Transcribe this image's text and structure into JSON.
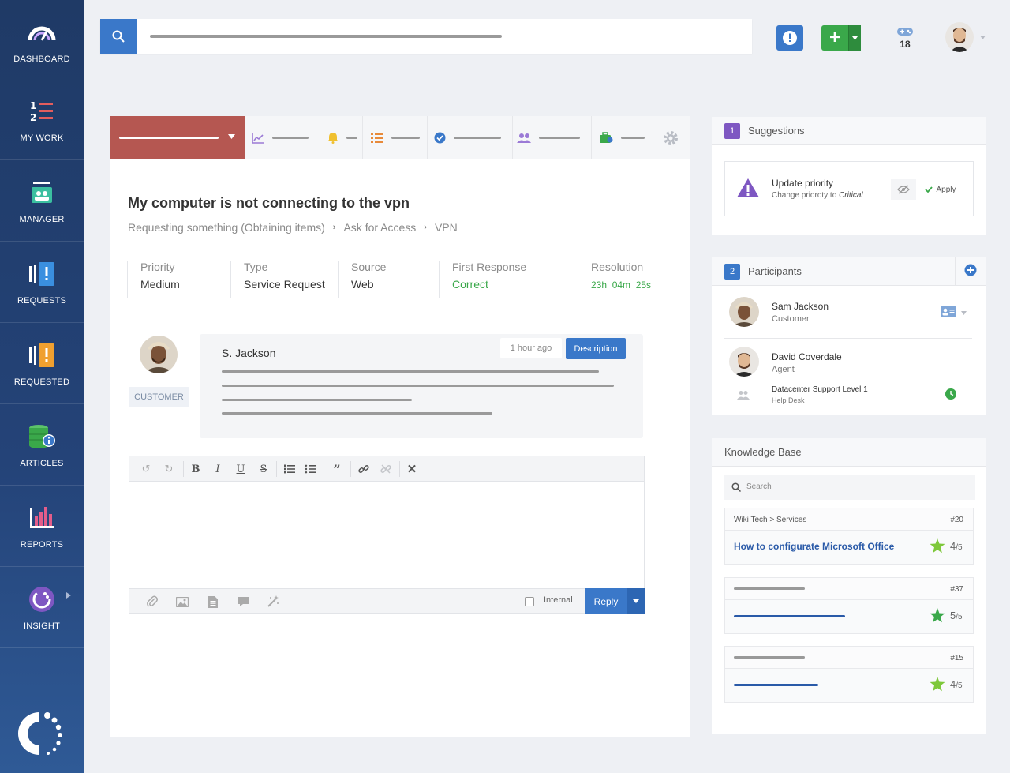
{
  "sidebar": {
    "items": [
      {
        "label": "DASHBOARD",
        "icon": "speedometer-icon"
      },
      {
        "label": "MY WORK",
        "icon": "numbered-list-icon"
      },
      {
        "label": "MANAGER",
        "icon": "manager-icon"
      },
      {
        "label": "REQUESTS",
        "icon": "requests-icon"
      },
      {
        "label": "REQUESTED",
        "icon": "requested-icon"
      },
      {
        "label": "ARTICLES",
        "icon": "database-icon"
      },
      {
        "label": "REPORTS",
        "icon": "bar-chart-icon"
      },
      {
        "label": "INSIGHT",
        "icon": "insight-icon"
      }
    ]
  },
  "topbar": {
    "notifications_count": "18"
  },
  "ticket": {
    "title": "My computer is not connecting to the vpn",
    "breadcrumb": [
      "Requesting something (Obtaining items)",
      "Ask for Access",
      "VPN"
    ],
    "meta": [
      {
        "key": "Priority",
        "value": "Medium"
      },
      {
        "key": "Type",
        "value": "Service Request"
      },
      {
        "key": "Source",
        "value": "Web"
      },
      {
        "key": "First Response",
        "value": "Correct"
      },
      {
        "key": "Resolution",
        "value": "23h  04m  25s"
      }
    ]
  },
  "message": {
    "author": "S. Jackson",
    "time": "1 hour ago",
    "tag": "Description",
    "role_tag": "CUSTOMER"
  },
  "editor": {
    "internal_label": "Internal",
    "reply_label": "Reply"
  },
  "suggestions": {
    "number": "1",
    "title": "Suggestions",
    "item_title": "Update priority",
    "item_sub": "Change prioroty to ",
    "item_sub_em": "Critical",
    "apply_label": "Apply"
  },
  "participants": {
    "number": "2",
    "title": "Participants",
    "people": [
      {
        "name": "Sam Jackson",
        "role": "Customer"
      },
      {
        "name": "David Coverdale",
        "role": "Agent"
      }
    ],
    "group": {
      "name": "Datacenter Support Level 1",
      "sub": "Help Desk"
    }
  },
  "knowledge_base": {
    "title": "Knowledge Base",
    "search_placeholder": "Search",
    "items": [
      {
        "path": "Wiki Tech > Services",
        "id": "#20",
        "title": "How to configurate Microsoft Office",
        "rating": "4",
        "max": "/5"
      },
      {
        "id": "#37",
        "rating": "5",
        "max": "/5"
      },
      {
        "id": "#15",
        "rating": "4",
        "max": "/5"
      }
    ]
  },
  "colors": {
    "sidebar": "#244378",
    "accent_blue": "#3a78c9",
    "tab_active": "#b55751",
    "green": "#3aa84a",
    "purple": "#7e57c2"
  }
}
